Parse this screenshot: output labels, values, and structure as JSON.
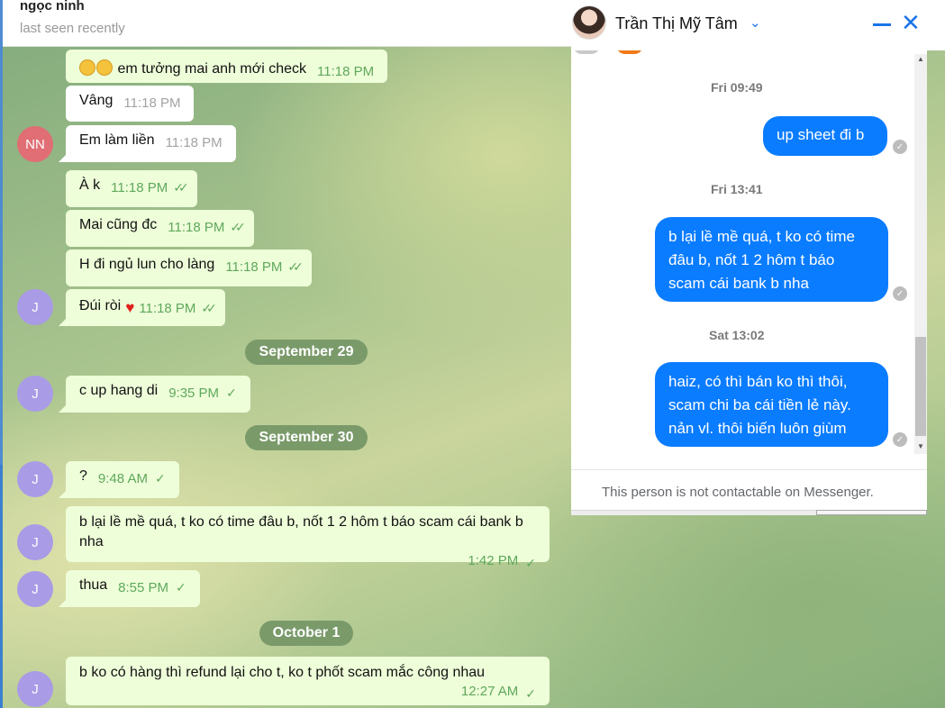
{
  "telegram": {
    "contact_name": "ngọc ninh",
    "status": "last seen recently",
    "messages": [
      {
        "text": "em tưởng mai anh mới check",
        "time": "11:18 PM"
      },
      {
        "text": "Vâng",
        "time": "11:18 PM"
      },
      {
        "text": "Em làm liền",
        "time": "11:18 PM"
      },
      {
        "text": "À k",
        "time": "11:18 PM"
      },
      {
        "text": "Mai cũng đc",
        "time": "11:18 PM"
      },
      {
        "text": "H đi ngủ lun cho làng",
        "time": "11:18 PM"
      },
      {
        "text": "Đúi ròi",
        "time": "11:18 PM"
      },
      {
        "text": "c up hang di",
        "time": "9:35 PM"
      },
      {
        "text": "?",
        "time": "9:48 AM"
      },
      {
        "text": "b lại lề mề quá, t ko có time đâu b, nốt 1 2 hôm t báo scam cái bank b nha",
        "time": "1:42 PM"
      },
      {
        "text": "thua",
        "time": "8:55 PM"
      },
      {
        "text": "b ko có hàng thì refund lại cho t, ko t phốt scam mắc công nhau",
        "time": "12:27 AM"
      }
    ],
    "dates": [
      "September 29",
      "September 30",
      "October 1"
    ],
    "avatars": {
      "nn": "NN",
      "j": "J"
    },
    "check_double": "✓✓",
    "check_single": "✓",
    "heart": "♥"
  },
  "messenger": {
    "contact_name": "Trần Thị Mỹ Tâm",
    "timestamps": [
      "Fri 09:49",
      "Fri 13:41",
      "Sat 13:02"
    ],
    "messages": [
      "up sheet đi b",
      "b lại lề mề quá, t ko có time đâu b, nốt 1 2 hôm t báo scam cái bank b nha",
      "haiz, có thì bán ko thì thôi, scam chi ba cái tiền lẻ này. nản vl. thôi biến luôn giùm"
    ],
    "footer": "This person is not contactable on Messenger.",
    "accent_color": "#0a7cff"
  }
}
